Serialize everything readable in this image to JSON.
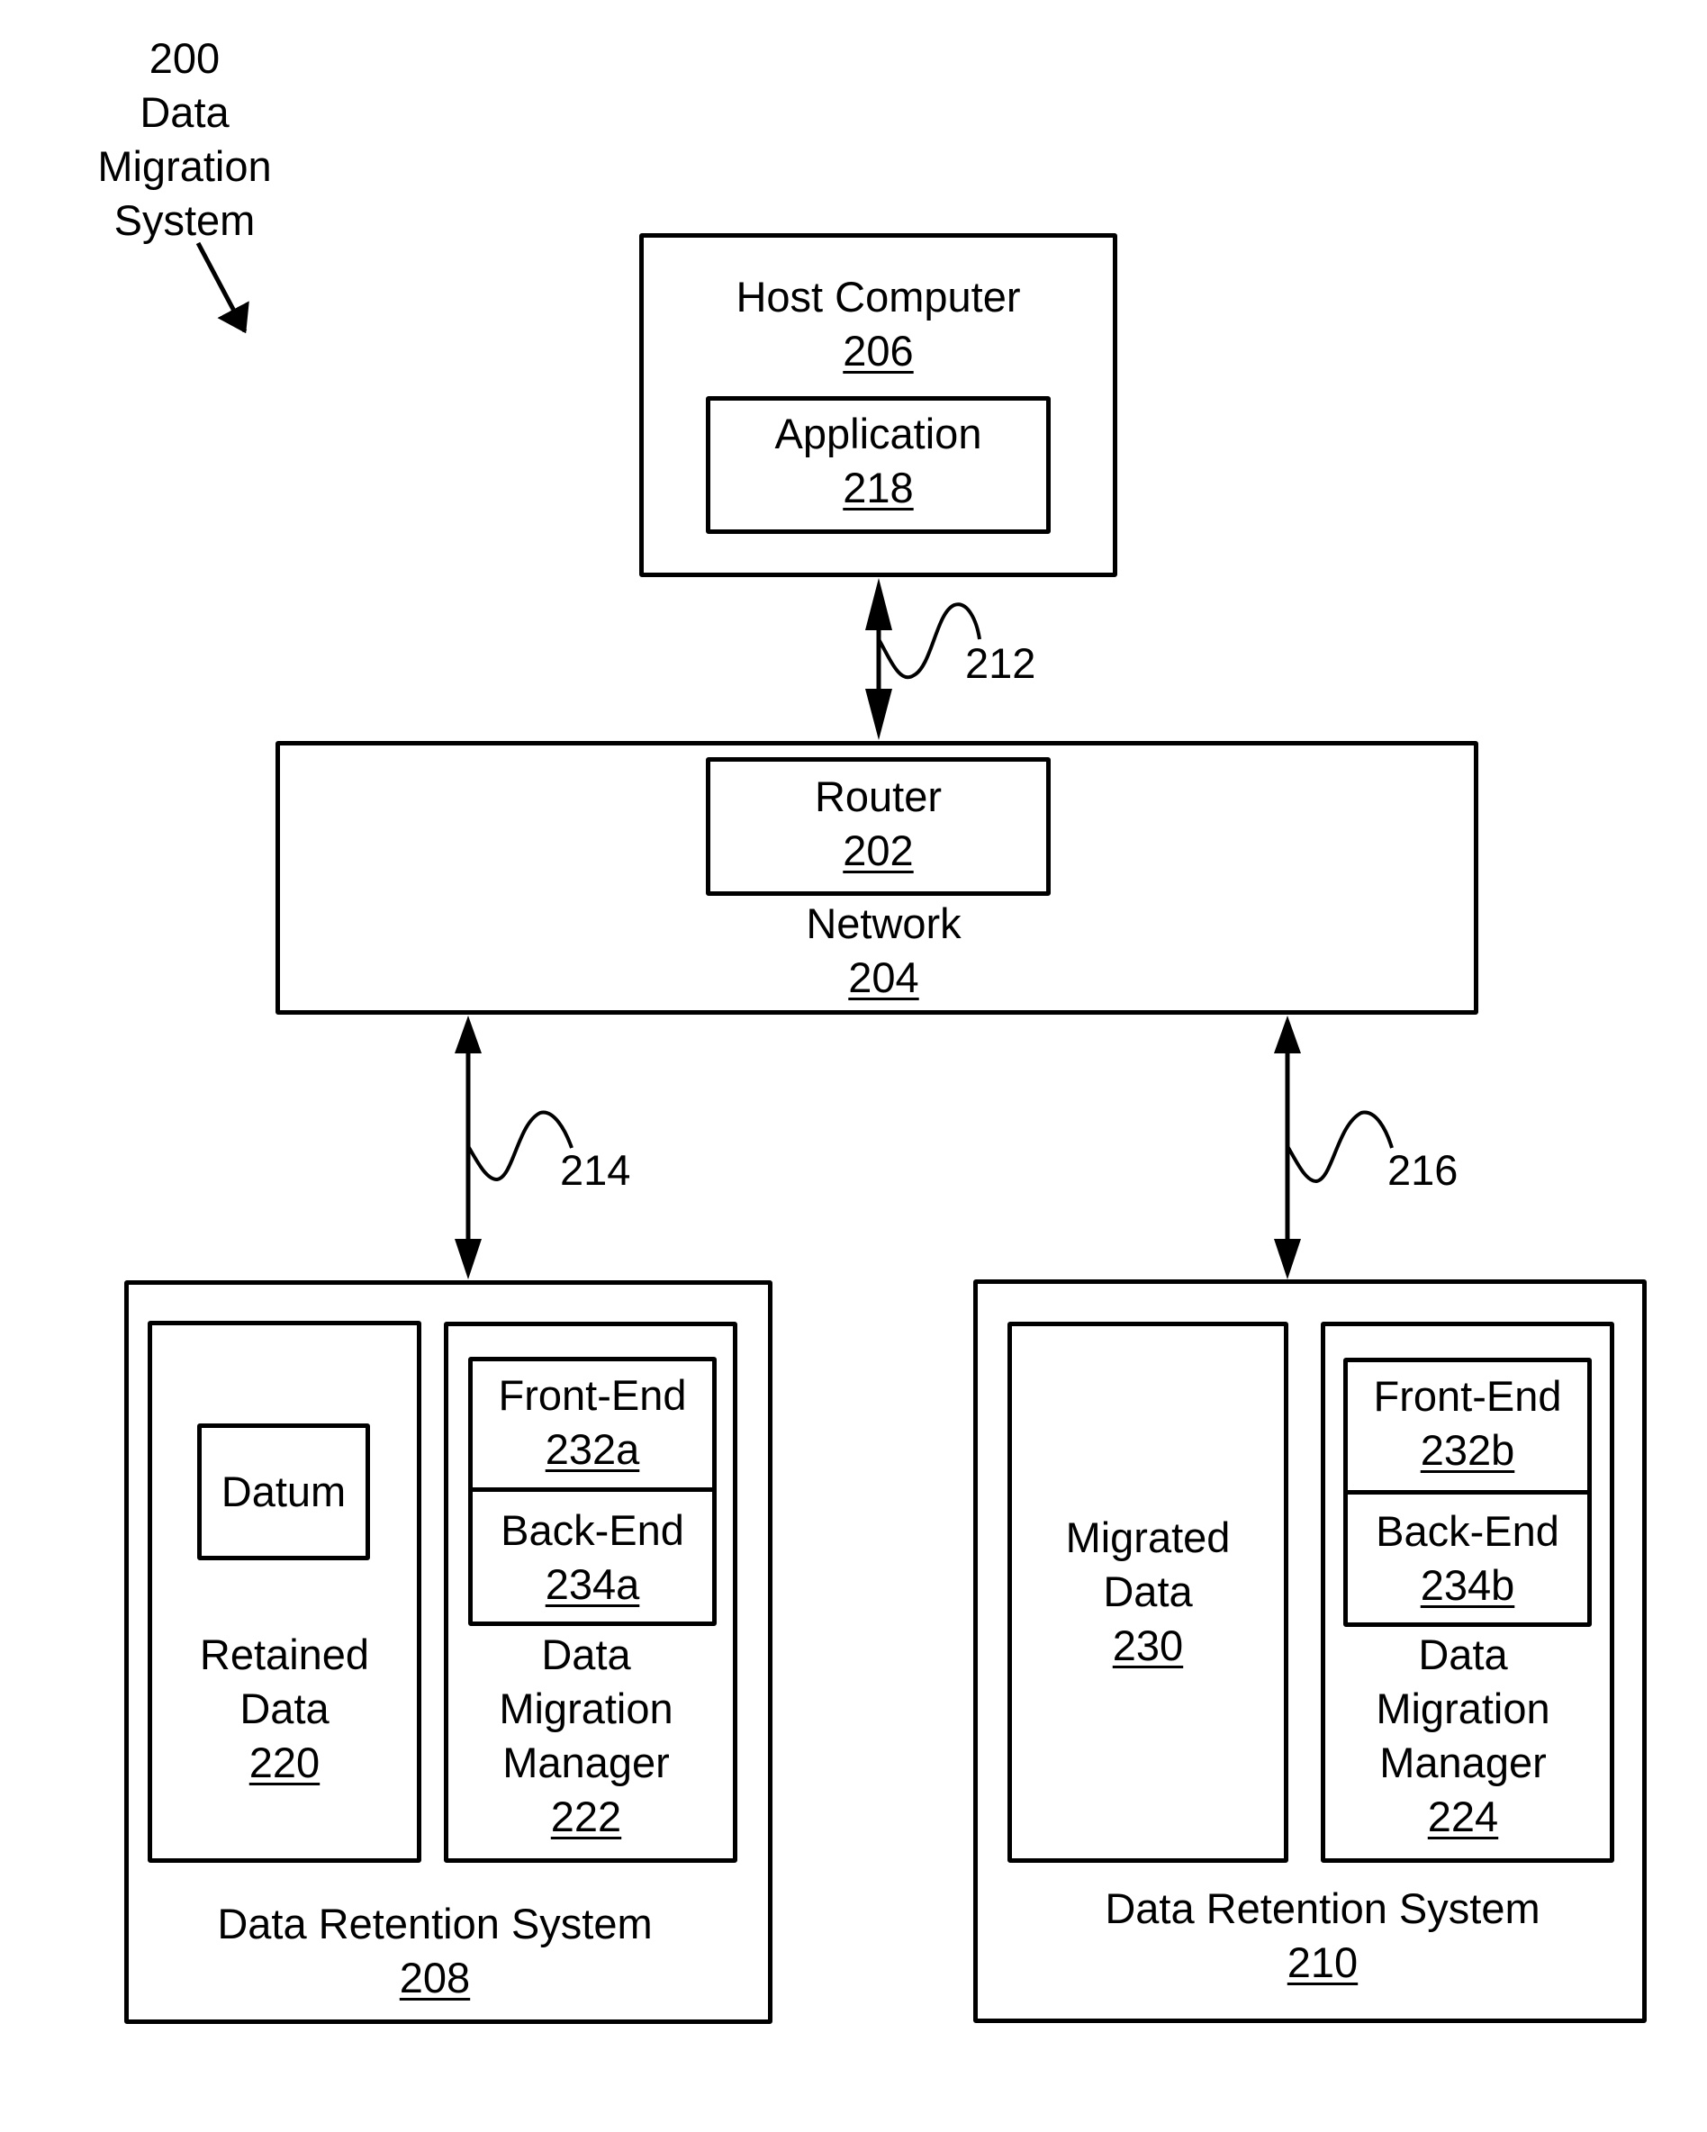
{
  "figure": {
    "title": {
      "number": "200",
      "lines": [
        "Data",
        "Migration",
        "System"
      ]
    }
  },
  "host_computer": {
    "label": "Host Computer",
    "ref": "206",
    "application": {
      "label": "Application",
      "ref": "218"
    }
  },
  "network": {
    "label": "Network",
    "ref": "204",
    "router": {
      "label": "Router",
      "ref": "202"
    }
  },
  "links": [
    {
      "ref": "212",
      "from": "Host Computer 206",
      "to": "Network 204",
      "direction": "bidirectional"
    },
    {
      "ref": "214",
      "from": "Network 204",
      "to": "Data Retention System 208",
      "direction": "bidirectional"
    },
    {
      "ref": "216",
      "from": "Network 204",
      "to": "Data Retention System 210",
      "direction": "bidirectional"
    }
  ],
  "drs_208": {
    "label": "Data Retention System",
    "ref": "208",
    "retained_data": {
      "lines": [
        "Retained",
        "Data"
      ],
      "ref": "220",
      "datum": "Datum"
    },
    "dmm": {
      "lines": [
        "Data",
        "Migration",
        "Manager"
      ],
      "ref": "222",
      "front_end": {
        "label": "Front-End",
        "ref": "232a"
      },
      "back_end": {
        "label": "Back-End",
        "ref": "234a"
      }
    }
  },
  "drs_210": {
    "label": "Data Retention System",
    "ref": "210",
    "migrated_data": {
      "lines": [
        "Migrated",
        "Data"
      ],
      "ref": "230"
    },
    "dmm": {
      "lines": [
        "Data",
        "Migration",
        "Manager"
      ],
      "ref": "224",
      "front_end": {
        "label": "Front-End",
        "ref": "232b"
      },
      "back_end": {
        "label": "Back-End",
        "ref": "234b"
      }
    }
  }
}
